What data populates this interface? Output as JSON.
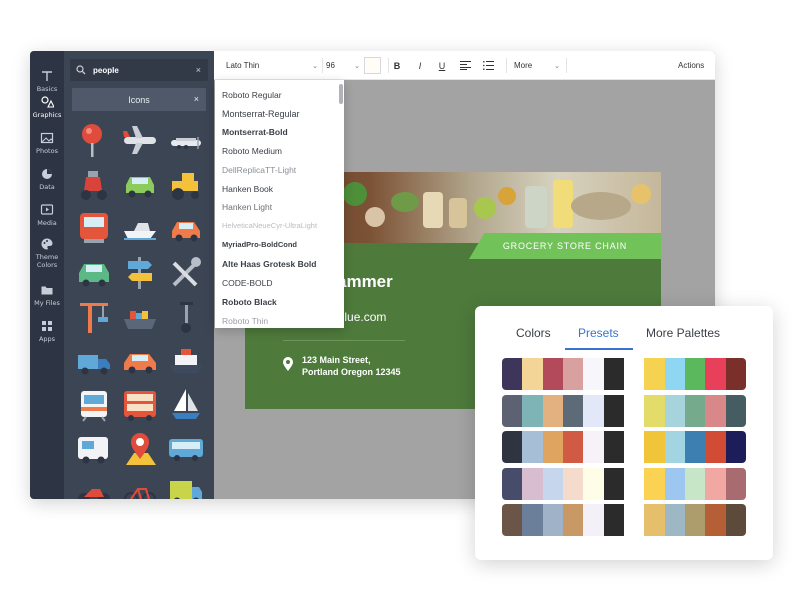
{
  "rail": [
    {
      "key": "basics",
      "label": "Basics",
      "icon": "text-icon"
    },
    {
      "key": "graphics",
      "label": "Graphics",
      "icon": "shapes-icon"
    },
    {
      "key": "photos",
      "label": "Photos",
      "icon": "image-icon"
    },
    {
      "key": "data",
      "label": "Data",
      "icon": "pie-chart-icon"
    },
    {
      "key": "media",
      "label": "Media",
      "icon": "play-icon"
    },
    {
      "key": "theme",
      "label": "Theme\nColors",
      "icon": "palette-icon"
    },
    {
      "key": "myfiles",
      "label": "My Files",
      "icon": "folder-icon"
    },
    {
      "key": "apps",
      "label": "Apps",
      "icon": "apps-grid-icon"
    }
  ],
  "panel": {
    "search_value": "people",
    "clear_glyph": "×",
    "chip_label": "Icons",
    "chip_close": "×",
    "icons": [
      "pushpin-icon",
      "airplane-icon",
      "propeller-plane-icon",
      "scooter-icon",
      "car-icon",
      "tractor-icon",
      "train-icon",
      "speedboat-icon",
      "hatchback-icon",
      "suv-icon",
      "signpost-icon",
      "tools-icon",
      "tower-crane-icon",
      "cargo-ship-icon",
      "segway-icon",
      "truck-icon",
      "sedan-icon",
      "ferry-icon",
      "tram-icon",
      "double-decker-bus-icon",
      "sailboat-icon",
      "camper-icon",
      "map-pin-icon",
      "bus-icon",
      "motorcycle-icon",
      "bicycle-icon",
      "delivery-truck-icon"
    ]
  },
  "toolbar": {
    "font_value": "Lato Thin",
    "size_value": "96",
    "bold": "B",
    "italic": "I",
    "underline": "U",
    "more_label": "More",
    "actions_label": "Actions"
  },
  "font_dropdown": {
    "items": [
      {
        "label": "Roboto Regular",
        "weight": "normal",
        "color": "#3a3f47"
      },
      {
        "label": "Montserrat-Regular",
        "weight": "normal",
        "color": "#2f343b"
      },
      {
        "label": "Montserrat-Bold",
        "weight": "bold",
        "color": "#2f343b"
      },
      {
        "label": "Roboto Medium",
        "weight": "normal",
        "color": "#3a3f47"
      },
      {
        "label": "DellReplicaTT-Light",
        "weight": "normal",
        "color": "#8a8f96"
      },
      {
        "label": "Hanken Book",
        "weight": "normal",
        "color": "#3a3f47"
      },
      {
        "label": "Hanken Light",
        "weight": "normal",
        "color": "#6a6f77"
      },
      {
        "label": "HelveticaNeueCyr-UltraLight",
        "weight": "normal",
        "color": "#b9bcc1"
      },
      {
        "label": "MyriadPro-BoldCond",
        "weight": "bold",
        "color": "#2f343b"
      },
      {
        "label": "Alte Haas Grotesk Bold",
        "weight": "bold",
        "color": "#2f343b"
      },
      {
        "label": "CODE-BOLD",
        "weight": "normal",
        "color": "#2f343b"
      },
      {
        "label": "Roboto Black",
        "weight": "bold",
        "color": "#1f2328"
      },
      {
        "label": "Roboto Thin",
        "weight": "normal",
        "color": "#9a9ea4"
      }
    ]
  },
  "card": {
    "ribbon": "GROCERY STORE CHAIN",
    "name_partial": "ammer",
    "web_partial": "tleblue.com",
    "address_line1": "123 Main Street,",
    "address_line2": "Portland Oregon 12345",
    "color": "#4e7a3c"
  },
  "palettes": {
    "tabs": [
      "Colors",
      "Presets",
      "More Palettes"
    ],
    "active_tab": "Presets",
    "accent": "#3a73cf",
    "rows": [
      [
        "#3d355a",
        "#f2d597",
        "#b34a5c",
        "#d9a0a0",
        "#f6f6fb",
        "#2b2b2b",
        "#ffffff",
        "#f5d250",
        "#8fd6f3",
        "#5cb85c",
        "#e8405a",
        "#7a2f2a"
      ],
      [
        "#5c6272",
        "#7fb4b6",
        "#e3b07f",
        "#5d6b78",
        "#e2e8f8",
        "#2b2b2b",
        "#ffffff",
        "#e4dc6a",
        "#a7d3dd",
        "#75ab8c",
        "#d88888",
        "#455c62"
      ],
      [
        "#2f3440",
        "#a7bfd6",
        "#e0a461",
        "#d15a44",
        "#f6f2f8",
        "#2b2b2b",
        "#ffffff",
        "#f0c53a",
        "#a2d4e2",
        "#3e7fb1",
        "#d24b35",
        "#1d1d5a"
      ],
      [
        "#474c6a",
        "#d8bcd0",
        "#c6d6ec",
        "#f5dbcc",
        "#fefee8",
        "#2b2b2b",
        "#ffffff",
        "#fbd251",
        "#9dc7f1",
        "#c7e6c7",
        "#f1a8a3",
        "#a86c70"
      ],
      [
        "#6a5548",
        "#6c7f9a",
        "#9fb2c7",
        "#c89965",
        "#f3f1f7",
        "#2b2b2b",
        "#ffffff",
        "#e6bf6d",
        "#9db7c4",
        "#ae9d6c",
        "#b45f36",
        "#5e4a3a"
      ]
    ]
  }
}
